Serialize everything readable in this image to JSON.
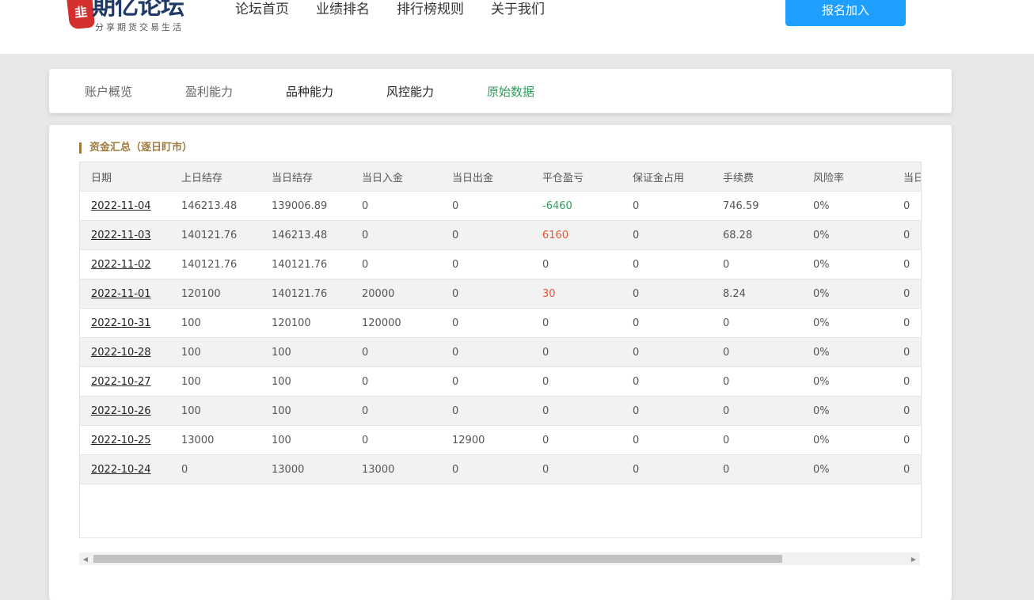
{
  "header": {
    "logo_seal": "韭",
    "logo_text": "期亿论坛",
    "logo_slogan": "分享期货交易生活",
    "nav": [
      "论坛首页",
      "业绩排名",
      "排行榜规则",
      "关于我们"
    ],
    "join_button": "报名加入"
  },
  "tabs": [
    "账户概览",
    "盈利能力",
    "品种能力",
    "风控能力",
    "原始数据"
  ],
  "active_tab": "原始数据",
  "section": {
    "title": "资金汇总（逐日盯市）"
  },
  "table": {
    "columns": [
      "日期",
      "上日结存",
      "当日结存",
      "当日入金",
      "当日出金",
      "平仓盈亏",
      "保证金占用",
      "手续费",
      "风险率",
      "当日"
    ],
    "rows": [
      [
        "2022-11-04",
        "146213.48",
        "139006.89",
        "0",
        "0",
        "-6460",
        "0",
        "746.59",
        "0%",
        "0"
      ],
      [
        "2022-11-03",
        "140121.76",
        "146213.48",
        "0",
        "0",
        "6160",
        "0",
        "68.28",
        "0%",
        "0"
      ],
      [
        "2022-11-02",
        "140121.76",
        "140121.76",
        "0",
        "0",
        "0",
        "0",
        "0",
        "0%",
        "0"
      ],
      [
        "2022-11-01",
        "120100",
        "140121.76",
        "20000",
        "0",
        "30",
        "0",
        "8.24",
        "0%",
        "0"
      ],
      [
        "2022-10-31",
        "100",
        "120100",
        "120000",
        "0",
        "0",
        "0",
        "0",
        "0%",
        "0"
      ],
      [
        "2022-10-28",
        "100",
        "100",
        "0",
        "0",
        "0",
        "0",
        "0",
        "0%",
        "0"
      ],
      [
        "2022-10-27",
        "100",
        "100",
        "0",
        "0",
        "0",
        "0",
        "0",
        "0%",
        "0"
      ],
      [
        "2022-10-26",
        "100",
        "100",
        "0",
        "0",
        "0",
        "0",
        "0",
        "0%",
        "0"
      ],
      [
        "2022-10-25",
        "13000",
        "100",
        "0",
        "12900",
        "0",
        "0",
        "0",
        "0%",
        "0"
      ],
      [
        "2022-10-24",
        "0",
        "13000",
        "13000",
        "0",
        "0",
        "0",
        "0",
        "0%",
        "0"
      ]
    ]
  },
  "colors": {
    "accent_blue": "#1e9fff",
    "active_tab_green": "#2e9e5a",
    "loss_green": "#2e9e5a",
    "profit_red": "#e8572c",
    "section_gold": "#a07a3c"
  },
  "icons": {
    "scroll_left": "◀",
    "scroll_right": "▶"
  }
}
